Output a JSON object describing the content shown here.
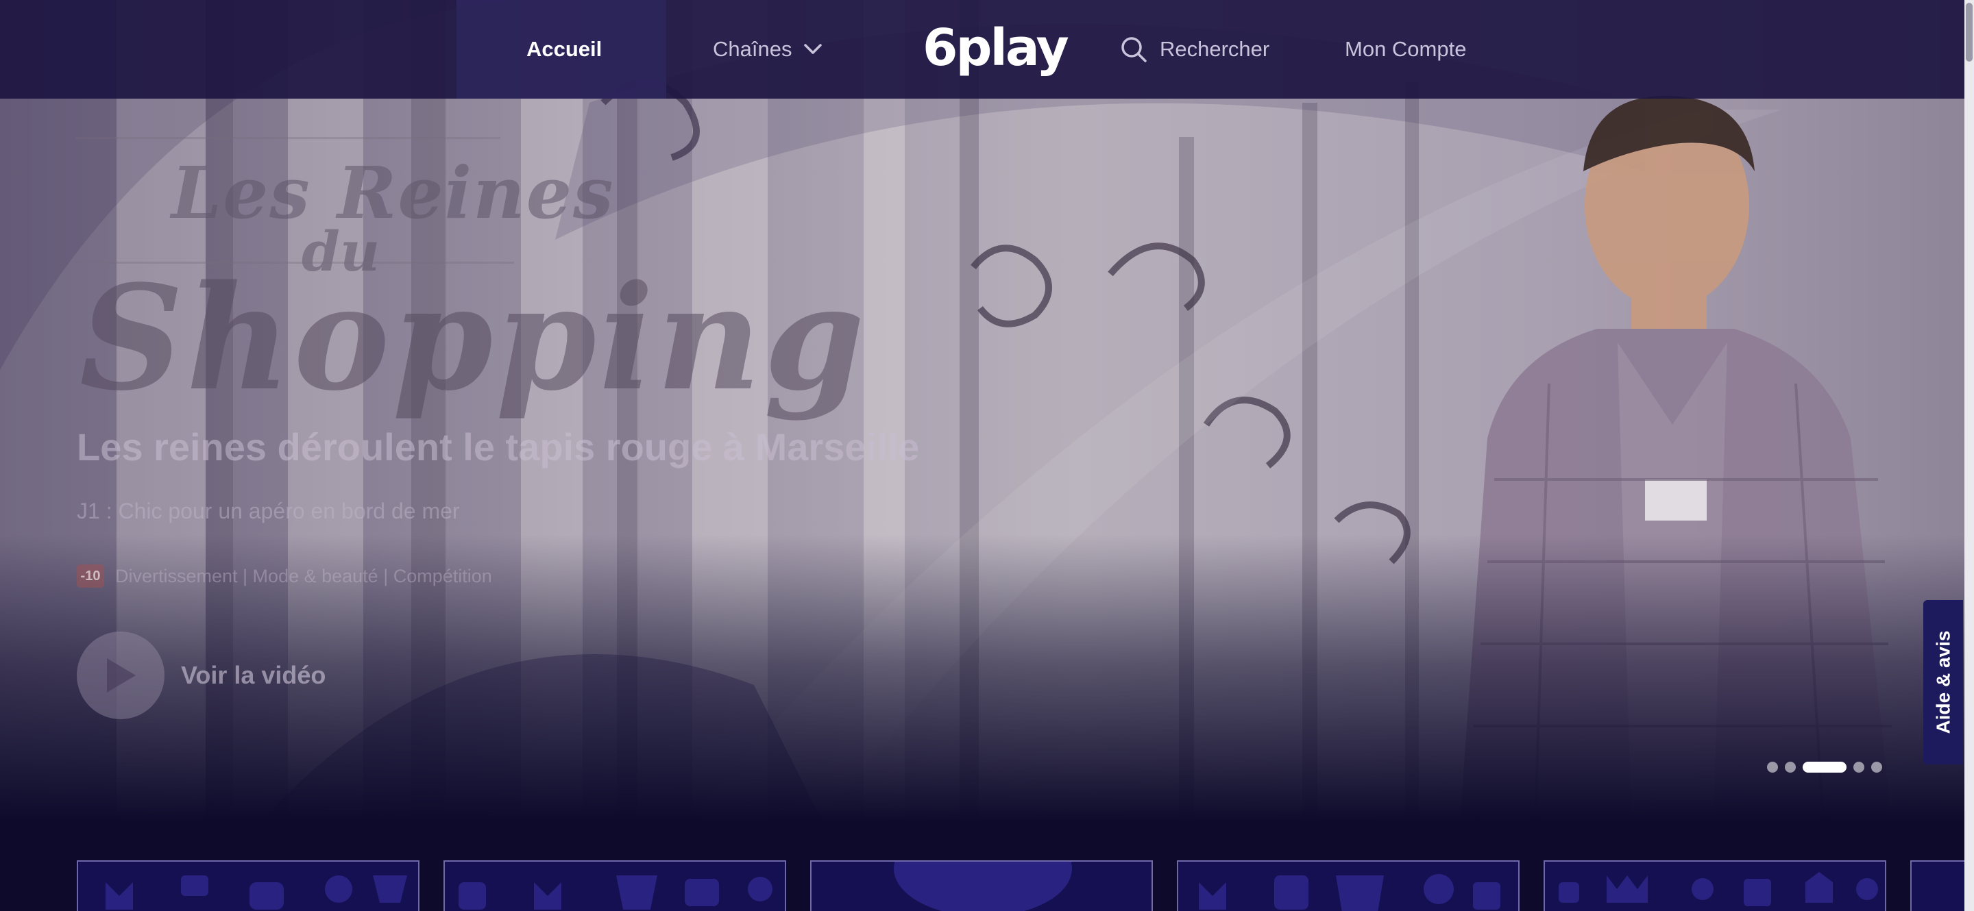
{
  "header": {
    "nav_home": "Accueil",
    "nav_channels": "Chaînes",
    "brand": "6play",
    "nav_search": "Rechercher",
    "nav_account": "Mon Compte"
  },
  "hero": {
    "show_logo_line1": "Les Reines",
    "show_logo_line2": "du",
    "show_logo_main": "Shopping",
    "episode_title": "Les reines déroulent le tapis rouge à Marseille",
    "episode_subtitle": "J1 : Chic pour un apéro en bord de mer",
    "rating": "-10",
    "genres": "Divertissement | Mode & beauté | Compétition",
    "play_label": "Voir la vidéo",
    "slide_count": 5,
    "active_slide_index": 3
  },
  "help_tab": {
    "label": "Aide & avis"
  },
  "colors": {
    "background": "#0d0a2b",
    "header": "#1d1642",
    "card": "#141052",
    "help_tab": "#1d1a5e"
  },
  "icons": {
    "channels_chevron": "chevron-down-icon",
    "search": "search-icon",
    "play": "play-icon"
  }
}
